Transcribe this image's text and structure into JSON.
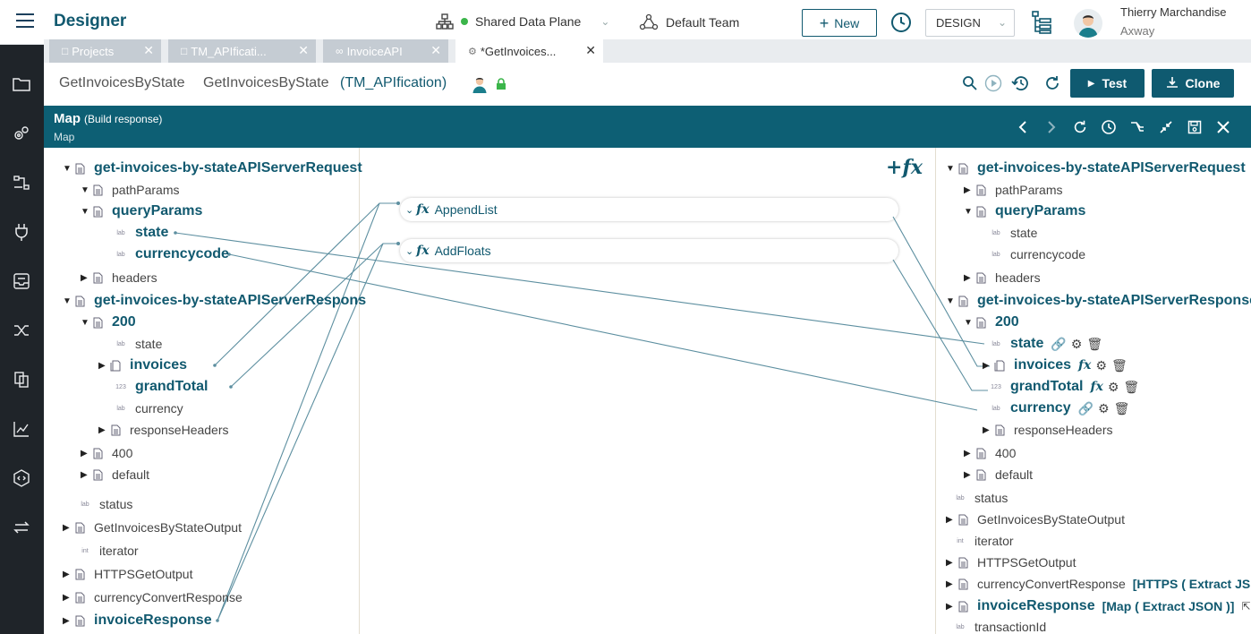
{
  "app": {
    "title": "Designer"
  },
  "topbar": {
    "data_plane": "Shared Data Plane",
    "team": "Default Team",
    "new_label": "New",
    "mode": "DESIGN",
    "user_name": "Thierry Marchandise",
    "user_org": "Axway"
  },
  "tabs": [
    {
      "label": "Projects"
    },
    {
      "label": "TM_APIficati..."
    },
    {
      "label": "InvoiceAPI"
    },
    {
      "label": "*GetInvoices..."
    }
  ],
  "breadcrumb": {
    "item1": "GetInvoicesByState",
    "item2": "GetInvoicesByState",
    "context": "(TM_APIfication)"
  },
  "actions": {
    "test": "Test",
    "clone": "Clone"
  },
  "map": {
    "title": "Map",
    "subtitle": "(Build response)",
    "caption": "Map"
  },
  "functions": [
    {
      "label": "AppendList"
    },
    {
      "label": "AddFloats"
    }
  ],
  "left_tree": {
    "req": "get-invoices-by-stateAPIServerRequest",
    "pathParams": "pathParams",
    "queryParams": "queryParams",
    "state": "state",
    "currencycode": "currencycode",
    "headers": "headers",
    "resp": "get-invoices-by-stateAPIServerRespons",
    "r200": "200",
    "r_state": "state",
    "invoices": "invoices",
    "grandTotal": "grandTotal",
    "currency": "currency",
    "responseHeaders": "responseHeaders",
    "r400": "400",
    "default": "default",
    "status": "status",
    "getOutput": "GetInvoicesByStateOutput",
    "iterator": "iterator",
    "httpsOutput": "HTTPSGetOutput",
    "ccResponse": "currencyConvertResponse",
    "invoiceResponse": "invoiceResponse"
  },
  "right_tree": {
    "req": "get-invoices-by-stateAPIServerRequest",
    "pathParams": "pathParams",
    "queryParams": "queryParams",
    "state": "state",
    "currencycode": "currencycode",
    "headers": "headers",
    "resp": "get-invoices-by-stateAPIServerResponse",
    "r200": "200",
    "r_state": "state",
    "invoices": "invoices",
    "grandTotal": "grandTotal",
    "currency": "currency",
    "responseHeaders": "responseHeaders",
    "r400": "400",
    "default": "default",
    "status": "status",
    "getOutput": "GetInvoicesByStateOutput",
    "iterator": "iterator",
    "httpsOutput": "HTTPSGetOutput",
    "ccResponse": "currencyConvertResponse",
    "ccExtra": "[HTTPS ( Extract JS",
    "invoiceResponse": "invoiceResponse",
    "irExtra": "[Map ( Extract JSON )]",
    "transactionId": "transactionId"
  },
  "colors": {
    "brand": "#11596f",
    "header_bar": "#0d5f74",
    "rail": "#1f2429",
    "wire": "#5d8fa0",
    "online": "#3bb54a"
  }
}
